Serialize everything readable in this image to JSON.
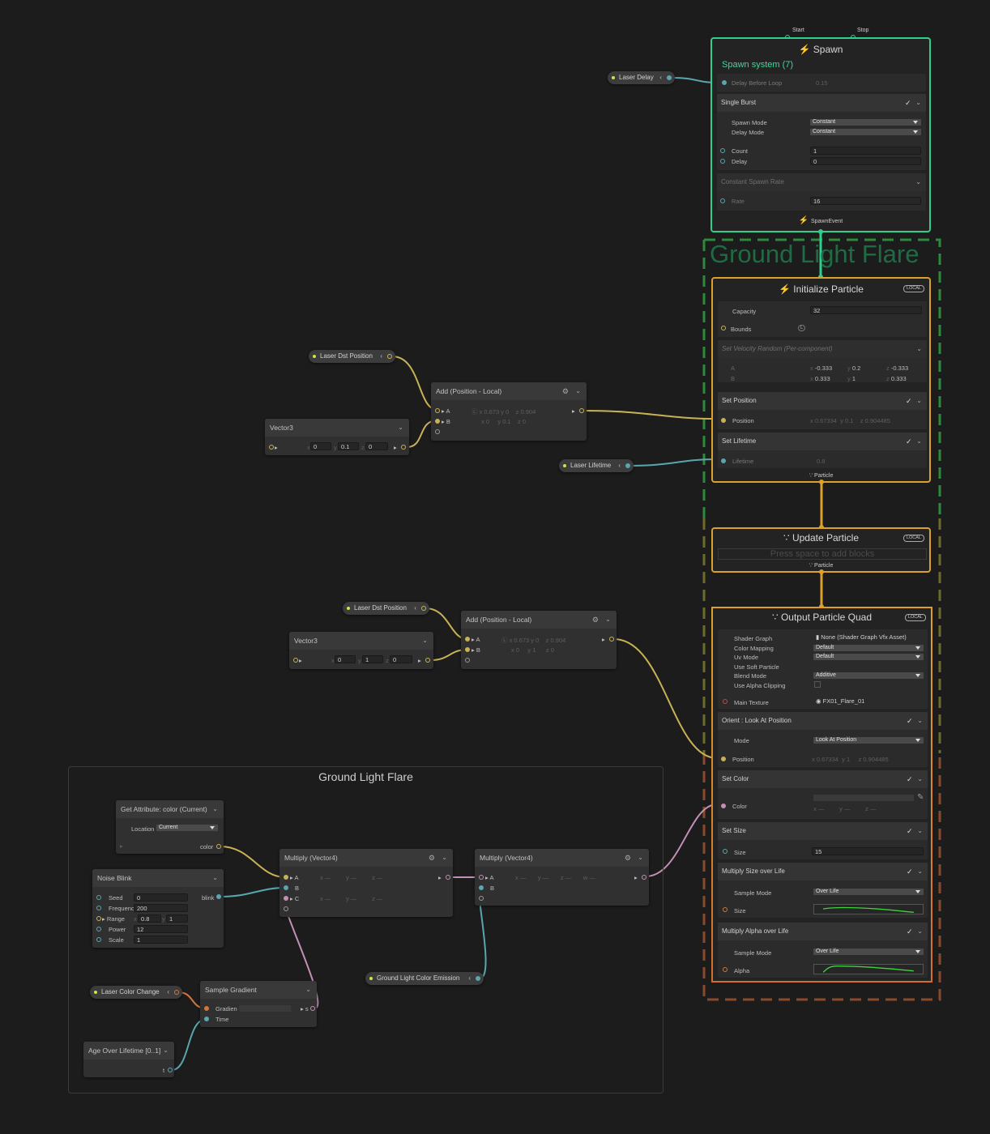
{
  "frames": {
    "main_title": "Ground Light Flare",
    "group_title": "Ground Light Flare"
  },
  "colors": {
    "spawn_border": "#2fcf8e",
    "init_border": "#dca12c",
    "output_border": "#d26d2e",
    "wire_yellow": "#c8b255",
    "wire_teal": "#5aa6b0",
    "wire_pink": "#c48fb6",
    "flare_outline_top": "#2c8a3a",
    "flare_outline_mid": "#6b6b2a",
    "flare_outline_bottom": "#8a4a2a"
  },
  "spawn": {
    "title": "Spawn",
    "start": "Start",
    "stop": "Stop",
    "system": "Spawn system (7)",
    "delay_before_loop": "Delay Before Loop",
    "delay_value": "0.15",
    "single_burst": "Single Burst",
    "spawn_mode_label": "Spawn Mode",
    "spawn_mode_value": "Constant",
    "delay_mode_label": "Delay Mode",
    "delay_mode_value": "Constant",
    "count_label": "Count",
    "count_value": "1",
    "delay_label": "Delay",
    "delay_field": "0",
    "constant_rate": "Constant Spawn Rate",
    "rate_label": "Rate",
    "rate_value": "16",
    "event": "SpawnEvent"
  },
  "init": {
    "title": "Initialize Particle",
    "local": "LOCAL",
    "capacity_label": "Capacity",
    "capacity_value": "32",
    "bounds_label": "Bounds",
    "vel_title": "Set Velocity Random (Per-component)",
    "a_label": "A",
    "b_label": "B",
    "ax": "-0.333",
    "ay": "0.2",
    "az": "-0.333",
    "bx": "0.333",
    "by": "1",
    "bz": "0.333",
    "set_position": "Set Position",
    "position_label": "Position",
    "pos_x": "0.67334",
    "pos_y": "0.1",
    "pos_z": "0.904485",
    "set_lifetime": "Set Lifetime",
    "lifetime_label": "Lifetime",
    "lifetime_value": "0.8",
    "footer": "Particle"
  },
  "update": {
    "title": "Update Particle",
    "local": "LOCAL",
    "hint": "Press space to add blocks",
    "footer": "Particle"
  },
  "output": {
    "title": "Output Particle Quad",
    "local": "LOCAL",
    "shader_graph_label": "Shader Graph",
    "shader_graph_value": "None (Shader Graph Vfx Asset)",
    "color_mapping_label": "Color Mapping",
    "color_mapping_value": "Default",
    "uv_mode_label": "Uv Mode",
    "uv_mode_value": "Default",
    "soft_particle_label": "Use Soft Particle",
    "blend_mode_label": "Blend Mode",
    "blend_mode_value": "Additive",
    "alpha_clipping_label": "Use Alpha Clipping",
    "main_texture_label": "Main Texture",
    "main_texture_value": "FX01_Flare_01",
    "orient_title": "Orient : Look At Position",
    "mode_label": "Mode",
    "mode_value": "Look At Position",
    "position_label": "Position",
    "pos_x": "0.67334",
    "pos_y": "1",
    "pos_z": "0.904485",
    "set_color": "Set Color",
    "color_label": "Color",
    "set_size": "Set Size",
    "size_label": "Size",
    "size_value": "15",
    "mult_size_title": "Multiply Size over Life",
    "sample_mode_label": "Sample Mode",
    "sample_mode_value": "Over Life",
    "size_curve_label": "Size",
    "mult_alpha_title": "Multiply Alpha over Life",
    "sample_mode2_value": "Over Life",
    "alpha_label": "Alpha"
  },
  "pills": {
    "laser_delay": "Laser Delay",
    "laser_dst_1": "Laser Dst Position",
    "laser_lifetime": "Laser Lifetime",
    "laser_dst_2": "Laser Dst Position",
    "laser_color_change": "Laser Color Change",
    "ground_emission": "Ground Light Color Emission"
  },
  "nodes": {
    "add1": {
      "title": "Add (Position - Local)",
      "a": "A",
      "b": "B",
      "ax": "0.673",
      "ay": "0",
      "az": "0.904",
      "bx": "0",
      "by": "0.1",
      "bz": "0"
    },
    "vec1": {
      "title": "Vector3",
      "x": "0",
      "y": "0.1",
      "z": "0"
    },
    "add2": {
      "title": "Add (Position - Local)",
      "a": "A",
      "b": "B",
      "ax": "0.673",
      "ay": "0",
      "az": "0.904",
      "bx": "0",
      "by": "1",
      "bz": "0"
    },
    "vec2": {
      "title": "Vector3",
      "x": "0",
      "y": "1",
      "z": "0"
    },
    "get_attr": {
      "title": "Get Attribute: color (Current)",
      "location_label": "Location",
      "location_value": "Current",
      "out": "color"
    },
    "noise": {
      "title": "Noise Blink",
      "seed_label": "Seed",
      "seed": "0",
      "freq_label": "Frequenc",
      "freq": "200",
      "range_label": "Range",
      "range_x": "0.8",
      "range_y": "1",
      "power_label": "Power",
      "power": "12",
      "scale_label": "Scale",
      "scale": "1",
      "out": "blink"
    },
    "mult1": {
      "title": "Multiply (Vector4)",
      "a": "A",
      "b": "B",
      "c": "C"
    },
    "mult2": {
      "title": "Multiply (Vector4)",
      "a": "A",
      "b": "B"
    },
    "sample_grad": {
      "title": "Sample Gradient",
      "gradient_label": "Gradien",
      "time_label": "Time",
      "out": "s"
    },
    "age": {
      "title": "Age Over Lifetime [0..1]",
      "out": "t"
    }
  },
  "axis": {
    "x": "x",
    "y": "y",
    "z": "z"
  }
}
